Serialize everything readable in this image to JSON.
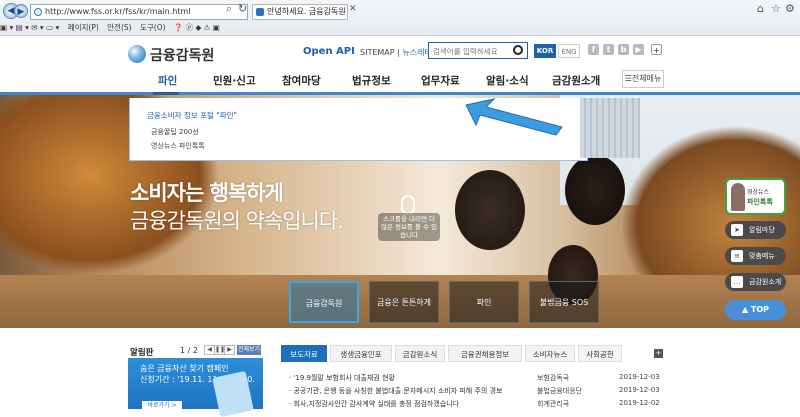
{
  "browser": {
    "address": "http://www.fss.or.kr/fss/kr/main.html",
    "tab_title": "안녕하세요. 금융감독원 홈...",
    "commands": [
      "페이지(P)",
      "안전(S)",
      "도구(O)"
    ]
  },
  "header": {
    "logo": "금융감독원",
    "open_api": "Open API",
    "sitemap": "SITEMAP",
    "newsletter": "뉴스레터",
    "search_placeholder": "검색어를 입력하세요",
    "lang_kor": "KOR",
    "lang_eng": "ENG"
  },
  "gnb": {
    "items": [
      "파인",
      "민원·신고",
      "참여마당",
      "법규정보",
      "업무자료",
      "알림·소식",
      "금감원소개"
    ],
    "all_menu": "전체메뉴"
  },
  "dropdown": {
    "title": "금융소비자 정보 포털 \"파인\"",
    "links": [
      "금융꿀팁 200선",
      "영상뉴스 파인톡톡"
    ]
  },
  "hero": {
    "slogan_line1": "소비자는 행복하게",
    "slogan_line2": "금융감독원의 약속입니다.",
    "caption": "스크롤을 내리면 더 많은 정보를 볼 수 있습니다",
    "thumbs": [
      "금융감독원",
      "금융은 튼튼하게",
      "파인",
      "불법금융 SOS"
    ]
  },
  "quick": {
    "badge_line1": "영상뉴스",
    "badge_line2": "파인톡톡",
    "buttons": [
      "알림마당",
      "맞춤메뉴",
      "금감원소개"
    ],
    "top": "TOP"
  },
  "notice": {
    "title": "알림판",
    "page": "1 / 2",
    "all_label": "전체보기",
    "banner_line1": "숨은 금융자산 찾기 캠페인",
    "banner_line2": "신청기간 : '19.11. 11 ~ 12.20.",
    "banner_more": "바로가기 >"
  },
  "news_tabs": [
    "보도자료",
    "생생금융인포",
    "금감원소식",
    "금융권채용정보",
    "소비자뉴스",
    "사회공헌"
  ],
  "news_rows": [
    {
      "title": "'19.9월말 보험회사 대출채권 현황",
      "org": "보험감독국",
      "date": "2019-12-03"
    },
    {
      "title": "공공기관, 은행 등을 사칭한 불법대출 문자메시지 소비자 피해 주의 경보",
      "org": "불법금융대응단",
      "date": "2019-12-03"
    },
    {
      "title": "회사,지정감사인간 감사계약 실태를 충정 점검하겠습니다",
      "org": "회계관리국",
      "date": "2019-12-02"
    }
  ],
  "colors": {
    "brand": "#1d5fa8",
    "accent": "#3a86d3",
    "tab_active": "#1d6fbd"
  }
}
